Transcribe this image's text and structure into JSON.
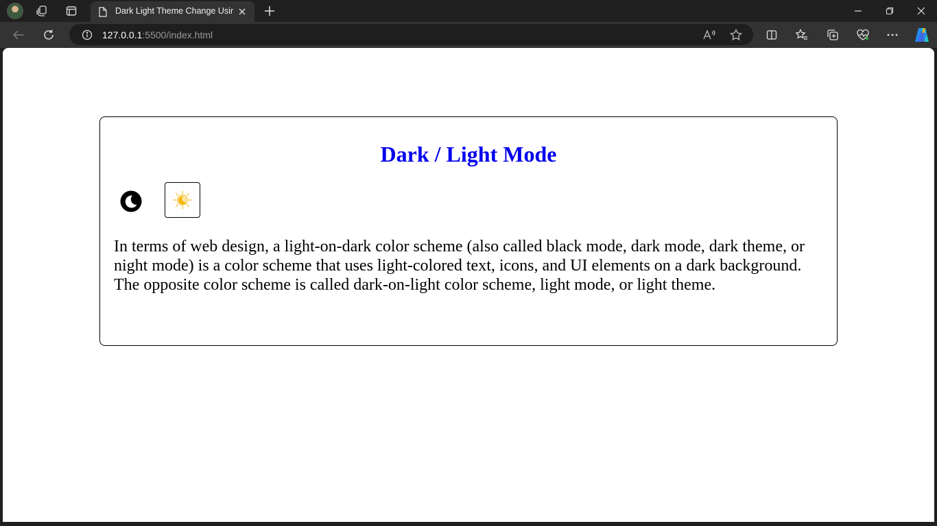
{
  "browser": {
    "tab_title": "Dark Light Theme Change Using",
    "url_host": "127.0.0.1",
    "url_path": ":5500/index.html",
    "icons": [
      "profile-avatar",
      "workspaces-icon",
      "tab-actions-icon",
      "page-icon",
      "close-icon",
      "new-tab-icon",
      "minimize-icon",
      "restore-icon",
      "window-close-icon",
      "back-icon",
      "reload-icon",
      "info-icon",
      "read-aloud-icon",
      "favorite-star-icon",
      "split-screen-icon",
      "favorites-icon",
      "collections-icon",
      "browser-essentials-icon",
      "more-icon",
      "copilot-icon"
    ]
  },
  "page": {
    "title": "Dark / Light Mode",
    "title_color": "#0000ee",
    "dark_button_icon": "moon-icon",
    "light_button_icon": "sun-moon-icon",
    "paragraph": "In terms of web design, a light-on-dark color scheme (also called black mode, dark mode, dark theme, or night mode) is a color scheme that uses light-colored text, icons, and UI elements on a dark background. The opposite color scheme is called dark-on-light color scheme, light mode, or light theme."
  }
}
